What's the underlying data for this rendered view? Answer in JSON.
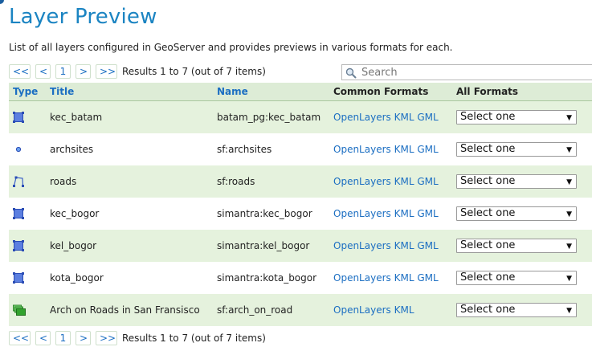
{
  "page": {
    "title": "Layer Preview",
    "description": "List of all layers configured in GeoServer and provides previews in various formats for each."
  },
  "pager": {
    "first": "<<",
    "prev": "<",
    "page": "1",
    "next": ">",
    "last": ">>",
    "results": "Results 1 to 7 (out of 7 items)"
  },
  "search": {
    "placeholder": "Search",
    "value": ""
  },
  "table": {
    "headers": {
      "type": "Type",
      "title": "Title",
      "name": "Name",
      "common": "Common Formats",
      "all": "All Formats"
    },
    "rows": [
      {
        "type_icon": "polygon-icon",
        "title": "kec_batam",
        "name": "batam_pg:kec_batam",
        "formats": [
          "OpenLayers",
          "KML",
          "GML"
        ],
        "select": "Select one"
      },
      {
        "type_icon": "point-icon",
        "title": "archsites",
        "name": "sf:archsites",
        "formats": [
          "OpenLayers",
          "KML",
          "GML"
        ],
        "select": "Select one"
      },
      {
        "type_icon": "line-icon",
        "title": "roads",
        "name": "sf:roads",
        "formats": [
          "OpenLayers",
          "KML",
          "GML"
        ],
        "select": "Select one"
      },
      {
        "type_icon": "polygon-icon",
        "title": "kec_bogor",
        "name": "simantra:kec_bogor",
        "formats": [
          "OpenLayers",
          "KML",
          "GML"
        ],
        "select": "Select one"
      },
      {
        "type_icon": "polygon-icon",
        "title": "kel_bogor",
        "name": "simantra:kel_bogor",
        "formats": [
          "OpenLayers",
          "KML",
          "GML"
        ],
        "select": "Select one"
      },
      {
        "type_icon": "polygon-icon",
        "title": "kota_bogor",
        "name": "simantra:kota_bogor",
        "formats": [
          "OpenLayers",
          "KML",
          "GML"
        ],
        "select": "Select one"
      },
      {
        "type_icon": "layer-group-icon",
        "title": "Arch on Roads in San Fransisco",
        "name": "sf:arch_on_road",
        "formats": [
          "OpenLayers",
          "KML"
        ],
        "select": "Select one"
      }
    ]
  },
  "colors": {
    "accent": "#1b84c2",
    "link": "#1b6ec2",
    "row_highlight": "#e5f2dd",
    "header_bg": "#ddecd6"
  }
}
